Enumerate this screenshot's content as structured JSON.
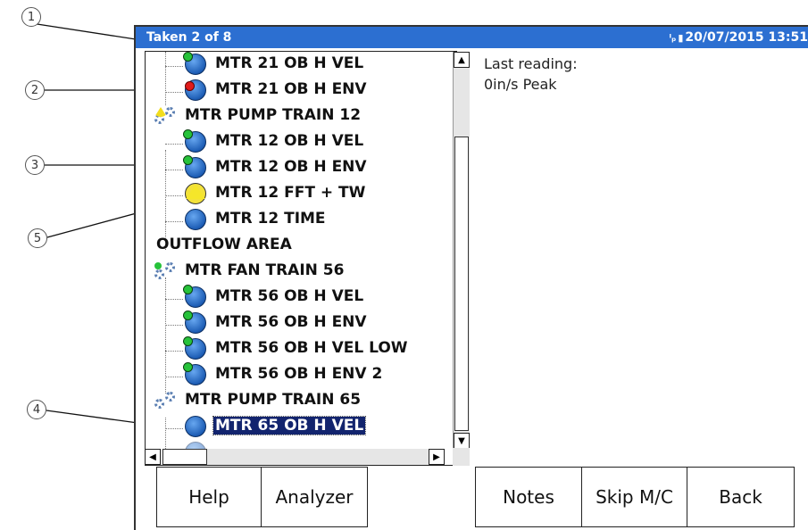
{
  "title_bar": {
    "status": "Taken 2 of 8",
    "datetime": "20/07/2015 13:51",
    "status_icons": [
      "ip-icon",
      "battery-icon"
    ],
    "color": "#2c6fd1"
  },
  "tree": {
    "items": [
      {
        "kind": "child",
        "label": "MTR 21 OB H VEL",
        "status": "green"
      },
      {
        "kind": "child",
        "label": "MTR 21 OB H ENV",
        "status": "red"
      },
      {
        "kind": "group",
        "label": "MTR PUMP TRAIN 12",
        "status": "yellow"
      },
      {
        "kind": "child",
        "label": "MTR 12 OB H VEL",
        "status": "green"
      },
      {
        "kind": "child",
        "label": "MTR 12 OB H ENV",
        "status": "green"
      },
      {
        "kind": "child",
        "label": "MTR 12 FFT + TW",
        "status": "yellow-triangle"
      },
      {
        "kind": "child",
        "label": "MTR 12 TIME",
        "status": "none"
      },
      {
        "kind": "area",
        "label": "OUTFLOW AREA"
      },
      {
        "kind": "group",
        "label": "MTR FAN TRAIN 56",
        "status": "green"
      },
      {
        "kind": "child",
        "label": "MTR 56 OB H VEL",
        "status": "green"
      },
      {
        "kind": "child",
        "label": "MTR 56 OB H ENV",
        "status": "green"
      },
      {
        "kind": "child",
        "label": "MTR 56 OB H VEL LOW",
        "status": "green"
      },
      {
        "kind": "child",
        "label": "MTR 56 OB H ENV 2",
        "status": "green"
      },
      {
        "kind": "group",
        "label": "MTR PUMP TRAIN 65",
        "status": "none"
      },
      {
        "kind": "child",
        "label": "MTR 65 OB H VEL",
        "status": "none",
        "selected": true
      }
    ]
  },
  "info_panel": {
    "line1": "Last reading:",
    "line2": "0in/s Peak"
  },
  "buttons": {
    "help": "Help",
    "analyzer": "Analyzer",
    "notes": "Notes",
    "skip": "Skip M/C",
    "back": "Back"
  },
  "callouts": [
    "1",
    "2",
    "3",
    "4",
    "5"
  ]
}
